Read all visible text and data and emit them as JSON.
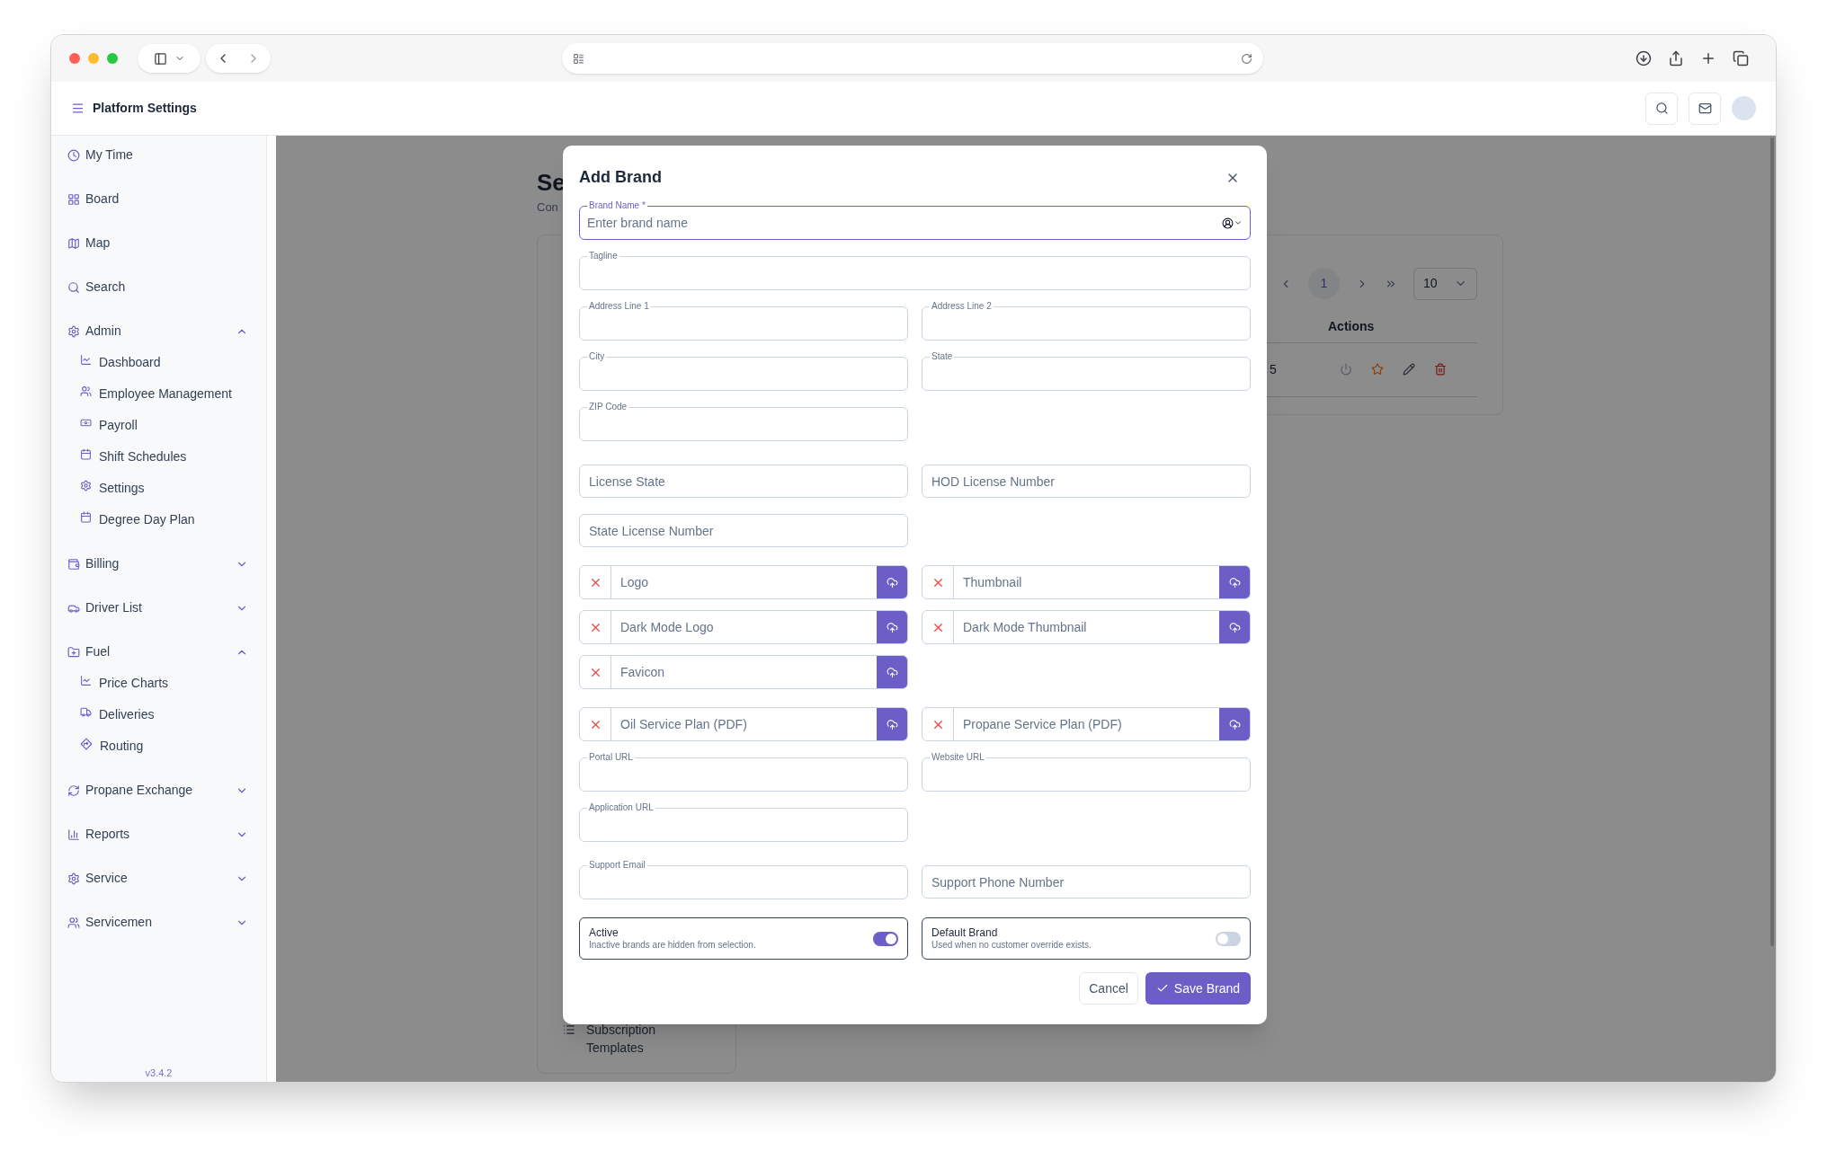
{
  "app_header": {
    "title": "Platform Settings"
  },
  "sidebar": {
    "items": [
      {
        "label": "My Time"
      },
      {
        "label": "Board"
      },
      {
        "label": "Map"
      },
      {
        "label": "Search"
      },
      {
        "label": "Admin",
        "expanded": true,
        "children": [
          {
            "label": "Dashboard"
          },
          {
            "label": "Employee Management"
          },
          {
            "label": "Payroll"
          },
          {
            "label": "Shift Schedules"
          },
          {
            "label": "Settings"
          },
          {
            "label": "Degree Day Plan"
          }
        ]
      },
      {
        "label": "Billing",
        "expanded": false
      },
      {
        "label": "Driver List",
        "expanded": false
      },
      {
        "label": "Fuel",
        "expanded": true,
        "children": [
          {
            "label": "Price Charts"
          },
          {
            "label": "Deliveries"
          },
          {
            "label": "Routing"
          }
        ]
      },
      {
        "label": "Propane Exchange",
        "expanded": false
      },
      {
        "label": "Reports",
        "expanded": false
      },
      {
        "label": "Service",
        "expanded": false
      },
      {
        "label": "Servicemen",
        "expanded": false
      }
    ],
    "version": "v3.4.2"
  },
  "background_page": {
    "title": "Se",
    "subtitle": "Con",
    "nav_item": "Subscription Templates",
    "pagination": {
      "page": "1",
      "page_size": "10"
    },
    "table": {
      "columns": [
        "Actions"
      ],
      "rows": [
        {
          "column_1": "5"
        }
      ]
    }
  },
  "dialog": {
    "title": "Add Brand",
    "sections": [
      {
        "rows": [
          [
            {
              "kind": "labeled_picker",
              "label": "Brand Name *",
              "placeholder": "Enter brand name",
              "focused": true
            }
          ],
          [
            {
              "kind": "labeled",
              "label": "Tagline",
              "focused": false
            }
          ],
          [
            {
              "kind": "labeled",
              "label": "Address Line 1",
              "focused": false
            },
            {
              "kind": "labeled",
              "label": "Address Line 2",
              "focused": false
            }
          ],
          [
            {
              "kind": "labeled",
              "label": "City",
              "focused": false
            },
            {
              "kind": "labeled",
              "label": "State",
              "focused": false
            }
          ],
          [
            {
              "kind": "labeled",
              "label": "ZIP Code",
              "focused": false
            }
          ]
        ]
      },
      {
        "rows": [
          [
            {
              "kind": "placeholder",
              "placeholder": "License State"
            },
            {
              "kind": "placeholder",
              "placeholder": "HOD License Number"
            }
          ],
          [
            {
              "kind": "placeholder",
              "placeholder": "State License Number"
            }
          ]
        ]
      },
      {
        "rows": [
          [
            {
              "kind": "upload",
              "label": "Logo"
            },
            {
              "kind": "upload",
              "label": "Thumbnail"
            }
          ],
          [
            {
              "kind": "upload",
              "label": "Dark Mode Logo"
            },
            {
              "kind": "upload",
              "label": "Dark Mode Thumbnail"
            }
          ],
          [
            {
              "kind": "upload",
              "label": "Favicon"
            }
          ]
        ]
      },
      {
        "rows": [
          [
            {
              "kind": "upload",
              "label": "Oil Service Plan (PDF)"
            },
            {
              "kind": "upload",
              "label": "Propane Service Plan (PDF)"
            }
          ],
          [
            {
              "kind": "labeled",
              "label": "Portal URL",
              "focused": false
            },
            {
              "kind": "labeled",
              "label": "Website URL",
              "focused": false
            }
          ],
          [
            {
              "kind": "labeled",
              "label": "Application URL",
              "focused": false
            }
          ]
        ]
      },
      {
        "rows": [
          [
            {
              "kind": "labeled",
              "label": "Support Email",
              "focused": false
            },
            {
              "kind": "placeholder",
              "placeholder": "Support Phone Number"
            }
          ]
        ]
      }
    ],
    "toggles": [
      {
        "title": "Active",
        "description": "Inactive brands are hidden from selection.",
        "on": true
      },
      {
        "title": "Default Brand",
        "description": "Used when no customer override exists.",
        "on": false
      }
    ],
    "buttons": {
      "cancel": "Cancel",
      "save": "Save Brand"
    }
  }
}
